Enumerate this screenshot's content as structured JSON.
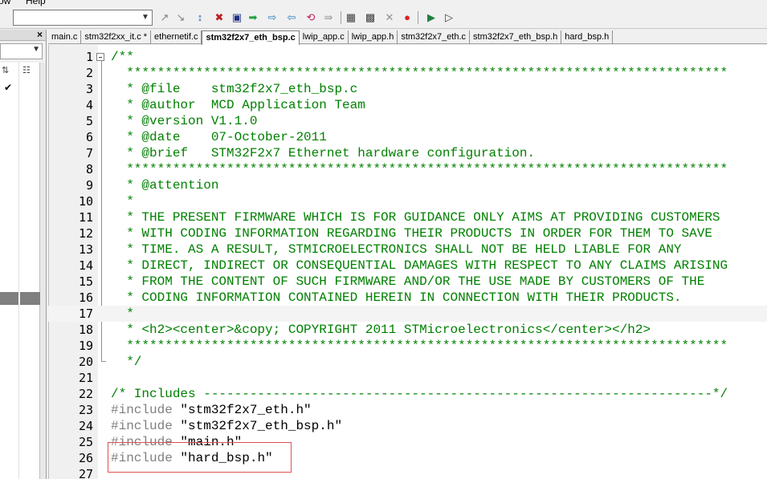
{
  "menu": {
    "items": [
      "ow",
      "Help"
    ]
  },
  "toolbar": {
    "combo_value": "",
    "buttons": [
      {
        "name": "insert-remove-breakpoint-icon",
        "glyph": "↗",
        "color": "#808080"
      },
      {
        "name": "enable-disable-breakpoint-icon",
        "glyph": "↘",
        "color": "#808080"
      },
      {
        "name": "disable-all-breakpoints-icon",
        "glyph": "↕",
        "color": "#1060c0"
      },
      {
        "name": "kill-all-breakpoints-icon",
        "glyph": "✖",
        "color": "#c02020"
      },
      {
        "name": "run-to-cursor-icon",
        "glyph": "▣",
        "color": "#203080"
      },
      {
        "name": "step-icon",
        "glyph": "➡",
        "color": "#20a040"
      },
      {
        "name": "step-over-icon",
        "glyph": "⇨",
        "color": "#2080c0"
      },
      {
        "name": "step-out-icon",
        "glyph": "⇦",
        "color": "#2080c0"
      },
      {
        "name": "show-next-statement-icon",
        "glyph": "⟲",
        "color": "#c02060"
      },
      {
        "name": "trace-icon",
        "glyph": "⇛",
        "color": "#a0a0a0"
      },
      {
        "name": "translate-icon",
        "glyph": "▦",
        "color": "#404040"
      },
      {
        "name": "build-icon",
        "glyph": "▩",
        "color": "#404040"
      },
      {
        "name": "stop-build-icon",
        "glyph": "✕",
        "color": "#909090"
      },
      {
        "name": "start-debug-icon",
        "glyph": "●",
        "color": "#e02020"
      },
      {
        "name": "download-icon",
        "glyph": "▶",
        "color": "#208040"
      },
      {
        "name": "options-icon",
        "glyph": "▷",
        "color": "#404040"
      }
    ]
  },
  "left_panel": {
    "close_glyph": "×",
    "icon1": "⇅",
    "icon2": "☷",
    "check": "✔"
  },
  "tabs": [
    {
      "label": "main.c",
      "active": false
    },
    {
      "label": "stm32f2xx_it.c *",
      "active": false
    },
    {
      "label": "ethernetif.c",
      "active": false
    },
    {
      "label": "stm32f2x7_eth_bsp.c",
      "active": true
    },
    {
      "label": "lwip_app.c",
      "active": false
    },
    {
      "label": "lwip_app.h",
      "active": false
    },
    {
      "label": "stm32f2x7_eth.c",
      "active": false
    },
    {
      "label": "stm32f2x7_eth_bsp.h",
      "active": false
    },
    {
      "label": "hard_bsp.h",
      "active": false
    }
  ],
  "colors": {
    "comment": "#008000",
    "preproc": "#808080",
    "string": "#000000",
    "highlight_box": "#e05050"
  },
  "code_lines": [
    {
      "n": "1",
      "parts": [
        {
          "t": "/**",
          "c": "comment"
        }
      ]
    },
    {
      "n": "2",
      "parts": [
        {
          "t": "  ******************************************************************************",
          "c": "comment"
        }
      ]
    },
    {
      "n": "3",
      "parts": [
        {
          "t": "  * @file    stm32f2x7_eth_bsp.c",
          "c": "comment"
        }
      ]
    },
    {
      "n": "4",
      "parts": [
        {
          "t": "  * @author  MCD Application Team",
          "c": "comment"
        }
      ]
    },
    {
      "n": "5",
      "parts": [
        {
          "t": "  * @version V1.1.0",
          "c": "comment"
        }
      ]
    },
    {
      "n": "6",
      "parts": [
        {
          "t": "  * @date    07-October-2011",
          "c": "comment"
        }
      ]
    },
    {
      "n": "7",
      "parts": [
        {
          "t": "  * @brief   STM32F2x7 Ethernet hardware configuration.",
          "c": "comment"
        }
      ]
    },
    {
      "n": "8",
      "parts": [
        {
          "t": "  ******************************************************************************",
          "c": "comment"
        }
      ]
    },
    {
      "n": "9",
      "parts": [
        {
          "t": "  * @attention",
          "c": "comment"
        }
      ]
    },
    {
      "n": "10",
      "parts": [
        {
          "t": "  *",
          "c": "comment"
        }
      ]
    },
    {
      "n": "11",
      "parts": [
        {
          "t": "  * THE PRESENT FIRMWARE WHICH IS FOR GUIDANCE ONLY AIMS AT PROVIDING CUSTOMERS",
          "c": "comment"
        }
      ]
    },
    {
      "n": "12",
      "parts": [
        {
          "t": "  * WITH CODING INFORMATION REGARDING THEIR PRODUCTS IN ORDER FOR THEM TO SAVE",
          "c": "comment"
        }
      ]
    },
    {
      "n": "13",
      "parts": [
        {
          "t": "  * TIME. AS A RESULT, STMICROELECTRONICS SHALL NOT BE HELD LIABLE FOR ANY",
          "c": "comment"
        }
      ]
    },
    {
      "n": "14",
      "parts": [
        {
          "t": "  * DIRECT, INDIRECT OR CONSEQUENTIAL DAMAGES WITH RESPECT TO ANY CLAIMS ARISING",
          "c": "comment"
        }
      ]
    },
    {
      "n": "15",
      "parts": [
        {
          "t": "  * FROM THE CONTENT OF SUCH FIRMWARE AND/OR THE USE MADE BY CUSTOMERS OF THE",
          "c": "comment"
        }
      ]
    },
    {
      "n": "16",
      "parts": [
        {
          "t": "  * CODING INFORMATION CONTAINED HEREIN IN CONNECTION WITH THEIR PRODUCTS.",
          "c": "comment"
        }
      ]
    },
    {
      "n": "17",
      "parts": [
        {
          "t": "  *",
          "c": "comment"
        }
      ],
      "highlight": true
    },
    {
      "n": "18",
      "parts": [
        {
          "t": "  * <h2><center>&copy; COPYRIGHT 2011 STMicroelectronics</center></h2>",
          "c": "comment"
        }
      ]
    },
    {
      "n": "19",
      "parts": [
        {
          "t": "  ******************************************************************************",
          "c": "comment"
        }
      ]
    },
    {
      "n": "20",
      "parts": [
        {
          "t": "  */",
          "c": "comment"
        }
      ]
    },
    {
      "n": "21",
      "parts": [
        {
          "t": "",
          "c": "comment"
        }
      ]
    },
    {
      "n": "22",
      "parts": [
        {
          "t": "/* Includes ------------------------------------------------------------------*/",
          "c": "comment"
        }
      ]
    },
    {
      "n": "23",
      "parts": [
        {
          "t": "#include ",
          "c": "preproc"
        },
        {
          "t": "\"stm32f2x7_eth.h\"",
          "c": "string"
        }
      ]
    },
    {
      "n": "24",
      "parts": [
        {
          "t": "#include ",
          "c": "preproc"
        },
        {
          "t": "\"stm32f2x7_eth_bsp.h\"",
          "c": "string"
        }
      ]
    },
    {
      "n": "25",
      "parts": [
        {
          "t": "#include ",
          "c": "preproc"
        },
        {
          "t": "\"main.h\"",
          "c": "string"
        }
      ]
    },
    {
      "n": "26",
      "parts": [
        {
          "t": "#include ",
          "c": "preproc"
        },
        {
          "t": "\"hard_bsp.h\"",
          "c": "string"
        }
      ]
    },
    {
      "n": "27",
      "parts": [
        {
          "t": "",
          "c": "comment"
        }
      ]
    }
  ]
}
